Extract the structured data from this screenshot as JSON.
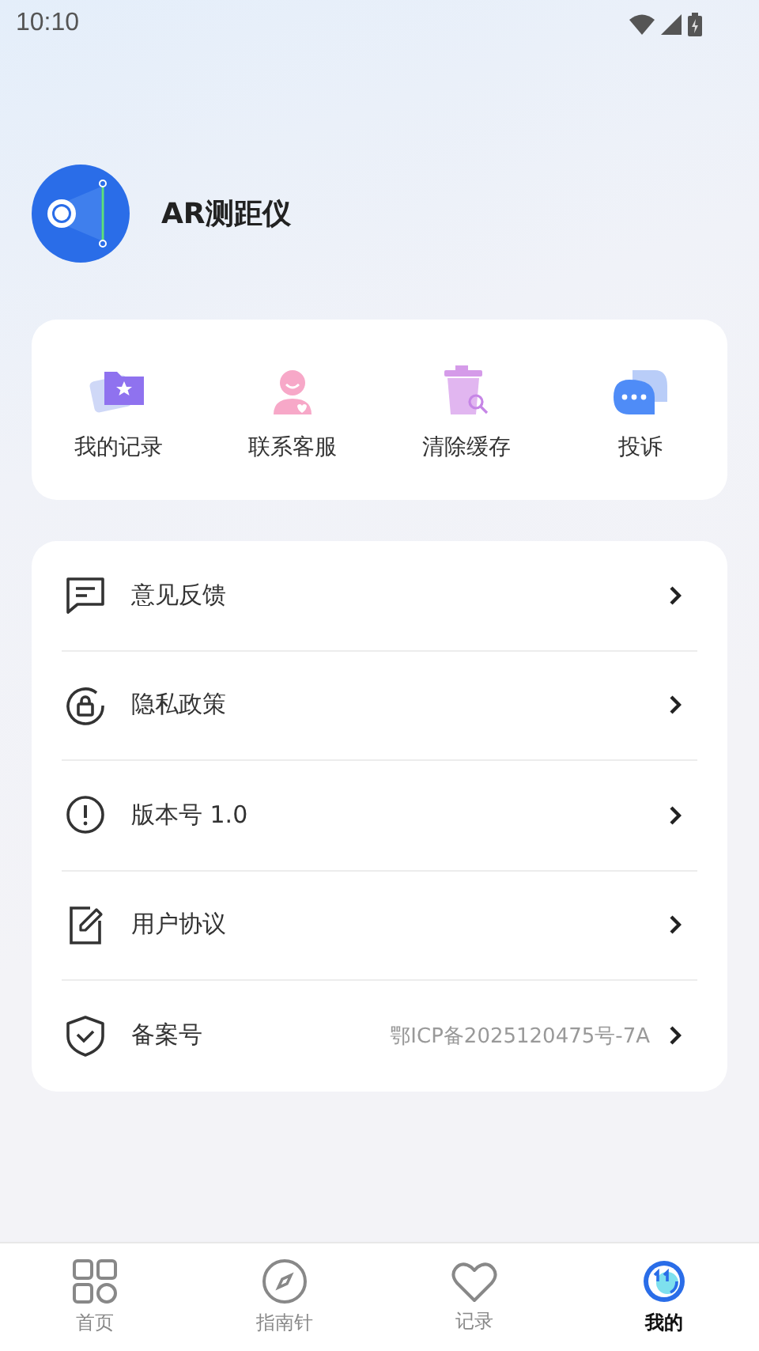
{
  "status_bar": {
    "time": "10:10"
  },
  "profile": {
    "app_name": "AR测距仪"
  },
  "quick_actions": [
    {
      "kind": "folder",
      "label": "我的记录"
    },
    {
      "kind": "agent",
      "label": "联系客服"
    },
    {
      "kind": "trash",
      "label": "清除缓存"
    },
    {
      "kind": "chat",
      "label": "投诉"
    }
  ],
  "menu": [
    {
      "kind": "feedback",
      "label": "意见反馈"
    },
    {
      "kind": "privacy",
      "label": "隐私政策"
    },
    {
      "kind": "info",
      "label": "版本号 1.0"
    },
    {
      "kind": "agreement",
      "label": "用户协议"
    },
    {
      "kind": "record",
      "label": "备案号",
      "value": "鄂ICP备2025120475号-7A"
    }
  ],
  "tab_bar": [
    {
      "kind": "home",
      "label": "首页",
      "selected": false
    },
    {
      "kind": "compass",
      "label": "指南针",
      "selected": false
    },
    {
      "kind": "heart",
      "label": "记录",
      "selected": false
    },
    {
      "kind": "mine",
      "label": "我的",
      "selected": true
    }
  ]
}
